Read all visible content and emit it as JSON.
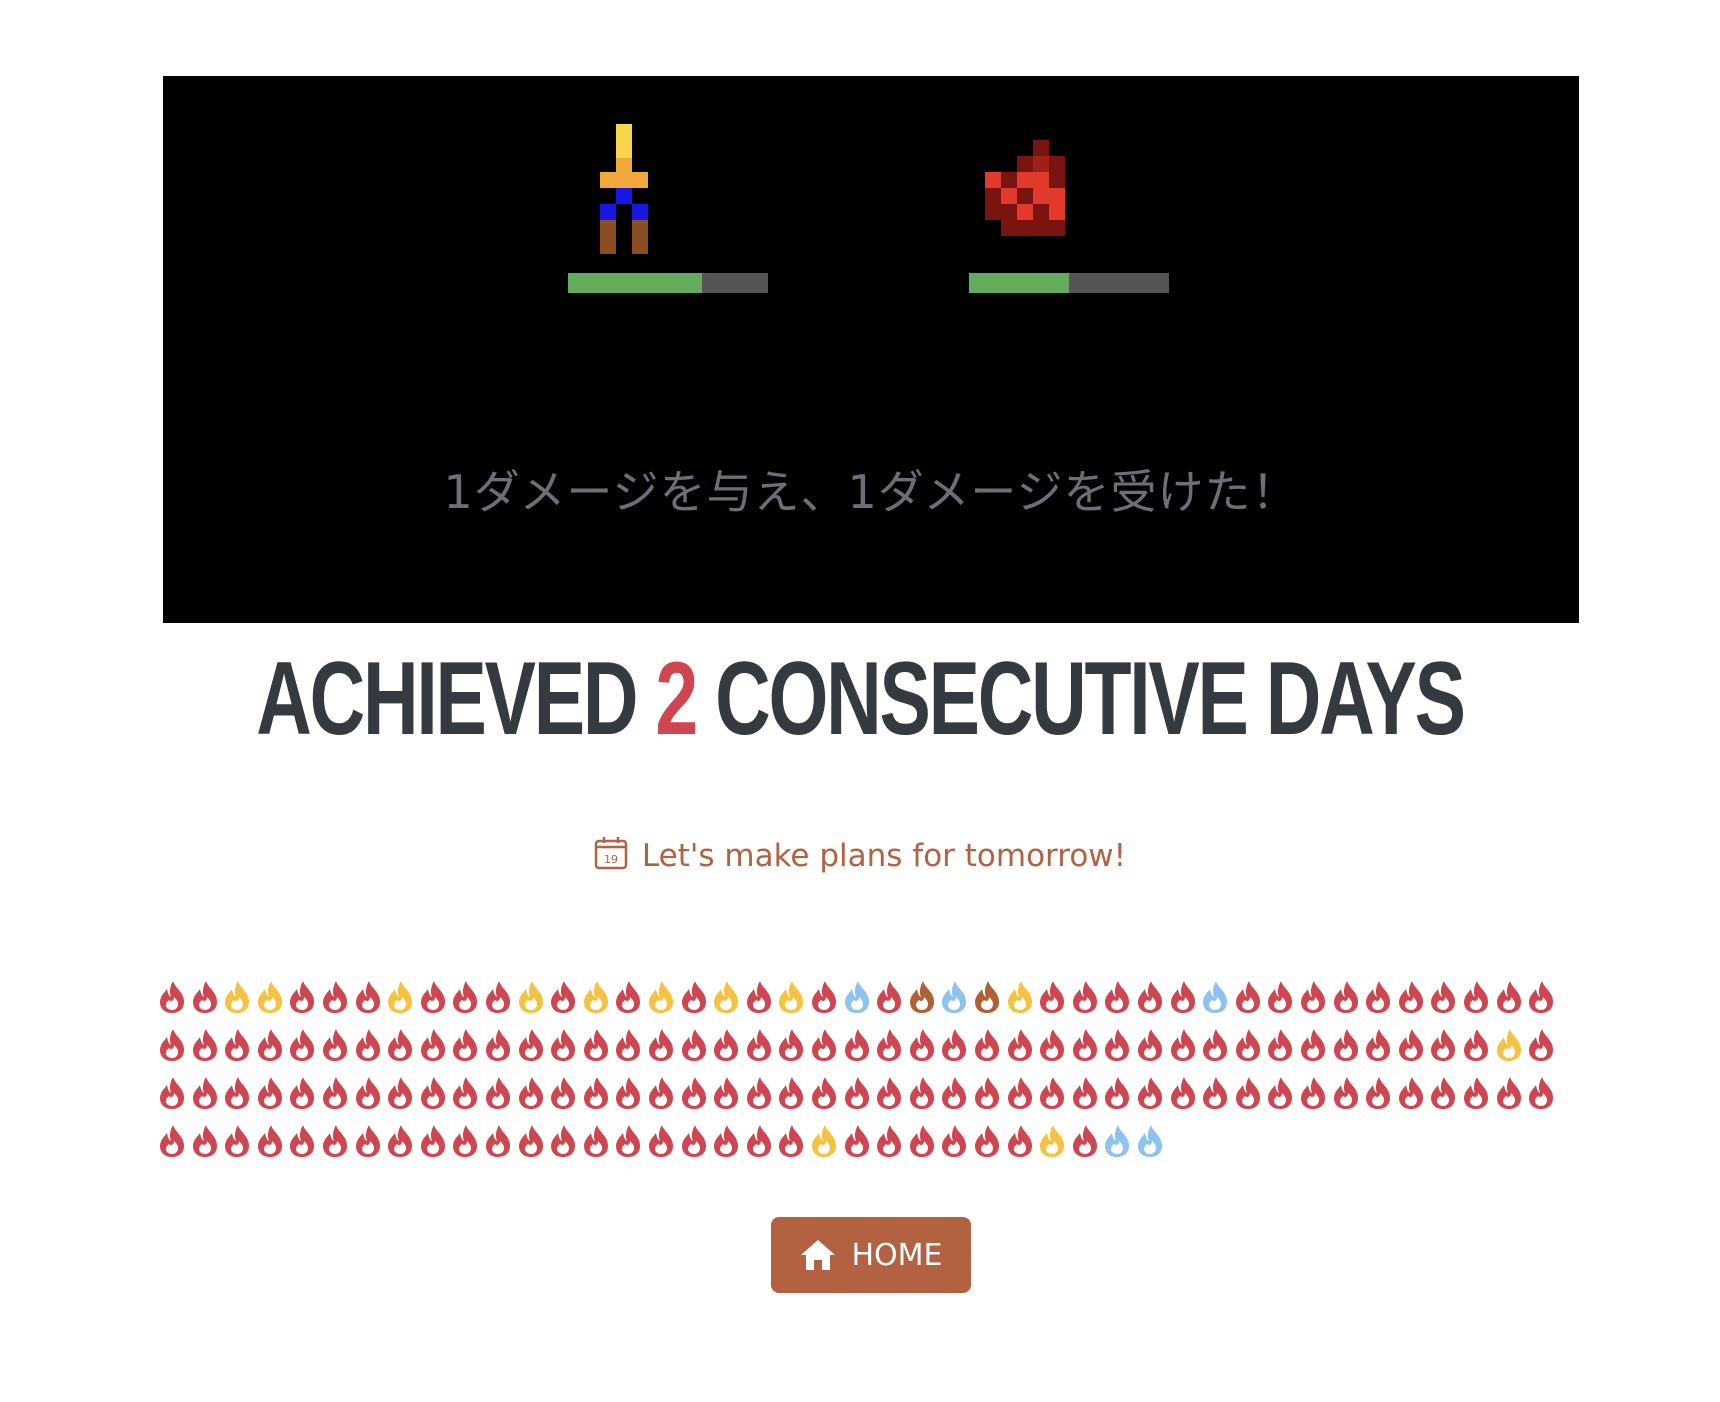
{
  "battle": {
    "message": "1ダメージを与え、1ダメージを受けた！",
    "player": {
      "name": "hero",
      "hp_fraction": 0.67
    },
    "enemy": {
      "name": "enemy",
      "hp_fraction": 0.5
    }
  },
  "headline": {
    "prefix": "ACHIEVED",
    "days": "2",
    "suffix": "CONSECUTIVE DAYS"
  },
  "plans": {
    "icon": "calendar-icon",
    "calendar_day": "19",
    "text": "Let's make plans for tomorrow!"
  },
  "streak": {
    "colors": {
      "red": "#d04650",
      "yellow": "#f5c242",
      "blue": "#8fc3ef",
      "brown": "#b06035"
    },
    "rows": [
      [
        "red",
        "red",
        "yellow",
        "yellow",
        "red",
        "red",
        "red",
        "yellow",
        "red",
        "red",
        "red",
        "yellow",
        "red",
        "yellow",
        "red",
        "yellow",
        "red",
        "yellow",
        "red",
        "yellow",
        "red",
        "blue",
        "red",
        "brown",
        "blue",
        "brown",
        "yellow",
        "red",
        "red",
        "red",
        "red",
        "red",
        "blue",
        "red",
        "red",
        "red",
        "red",
        "red",
        "red",
        "red",
        "red",
        "red",
        "red"
      ],
      [
        "red",
        "red",
        "red",
        "red",
        "red",
        "red",
        "red",
        "red",
        "red",
        "red",
        "red",
        "red",
        "red",
        "red",
        "red",
        "red",
        "red",
        "red",
        "red",
        "red",
        "red",
        "red",
        "red",
        "red",
        "red",
        "red",
        "red",
        "red",
        "red",
        "red",
        "red",
        "red",
        "red",
        "red",
        "red",
        "red",
        "red",
        "red",
        "red",
        "red",
        "red",
        "yellow",
        "red"
      ],
      [
        "red",
        "red",
        "red",
        "red",
        "red",
        "red",
        "red",
        "red",
        "red",
        "red",
        "red",
        "red",
        "red",
        "red",
        "red",
        "red",
        "red",
        "red",
        "red",
        "red",
        "red",
        "red",
        "red",
        "red",
        "red",
        "red",
        "red",
        "red",
        "red",
        "red",
        "red",
        "red",
        "red",
        "red",
        "red",
        "red",
        "red",
        "red",
        "red",
        "red",
        "red",
        "red",
        "red"
      ],
      [
        "red",
        "red",
        "red",
        "red",
        "red",
        "red",
        "red",
        "red",
        "red",
        "red",
        "red",
        "red",
        "red",
        "red",
        "red",
        "red",
        "red",
        "red",
        "red",
        "red",
        "yellow",
        "red",
        "red",
        "red",
        "red",
        "red",
        "red",
        "yellow",
        "red",
        "blue",
        "blue"
      ]
    ]
  },
  "home_button": {
    "label": "HOME",
    "icon": "home-icon"
  }
}
